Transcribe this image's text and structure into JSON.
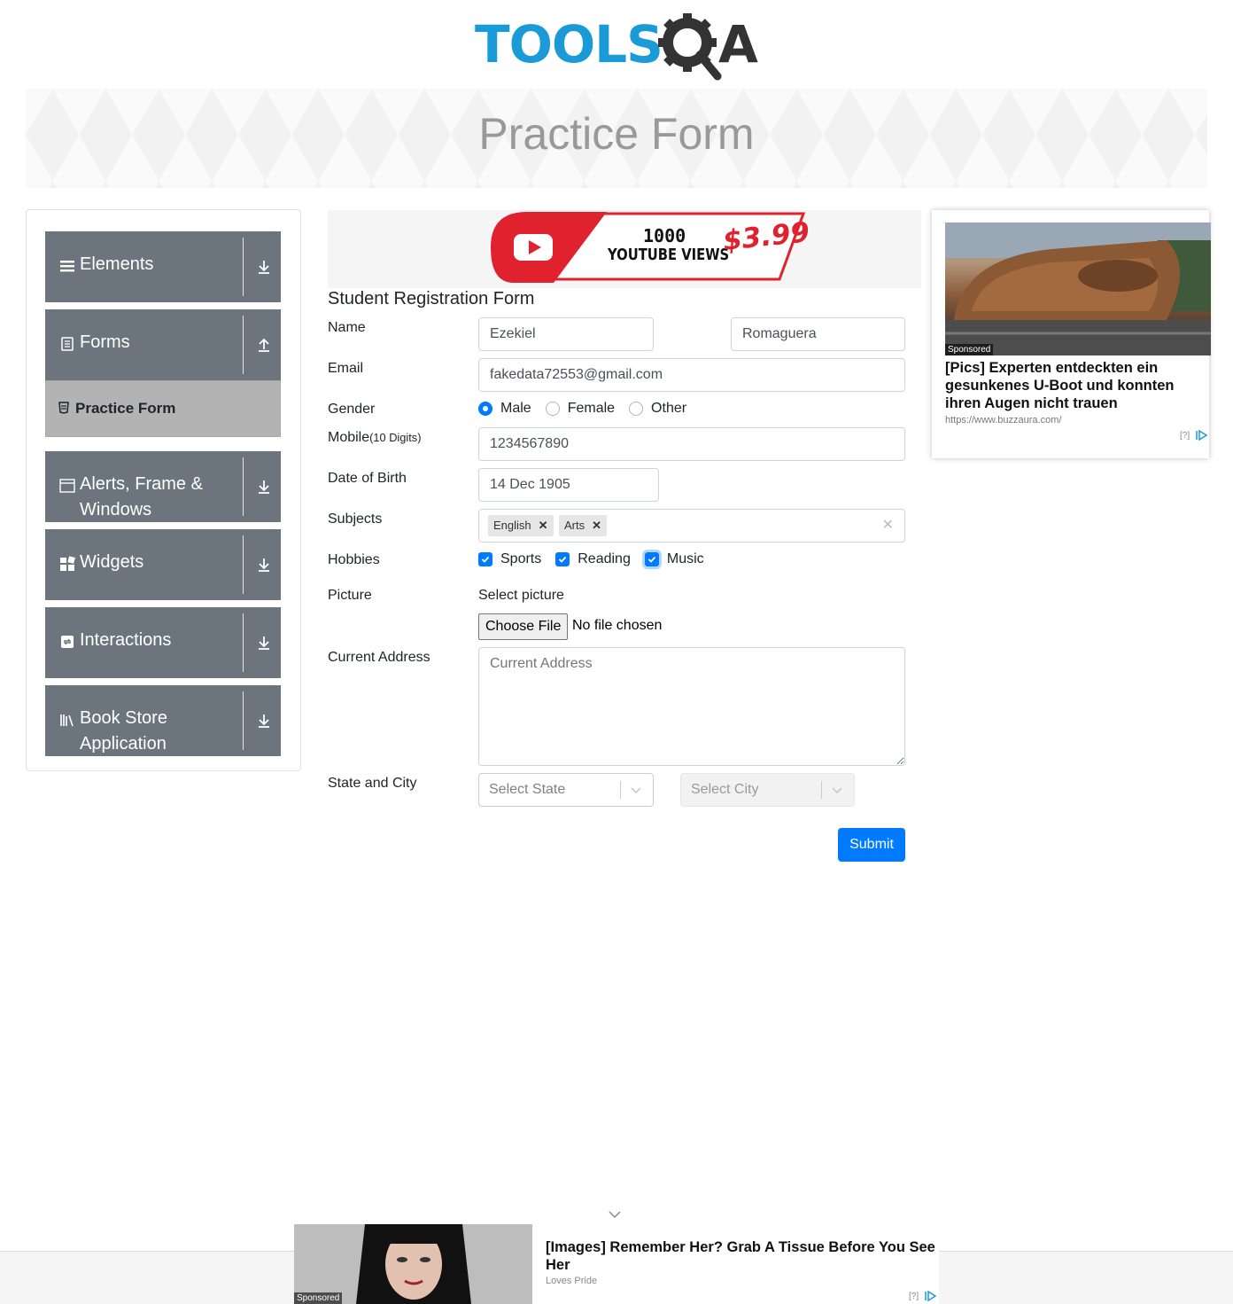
{
  "header": {
    "logo_text": "TOOLS",
    "logo_suffix": "A"
  },
  "banner": {
    "title": "Practice Form"
  },
  "sidebar": {
    "groups": [
      {
        "label": "Elements",
        "icon": "hamburger-icon",
        "toggle": "download-icon"
      },
      {
        "label": "Forms",
        "icon": "document-icon",
        "toggle": "upload-icon"
      },
      {
        "label": "Alerts, Frame & Windows",
        "icon": "window-icon",
        "toggle": "download-icon"
      },
      {
        "label": "Widgets",
        "icon": "widgets-icon",
        "toggle": "download-icon"
      },
      {
        "label": "Interactions",
        "icon": "interactions-icon",
        "toggle": "download-icon"
      },
      {
        "label": "Book Store Application",
        "icon": "books-icon",
        "toggle": "download-icon"
      }
    ],
    "active_item": "Practice Form"
  },
  "ad_top": {
    "line1": "1000",
    "line2": "YOUTUBE VIEWS",
    "price": "$3.99"
  },
  "form": {
    "title": "Student Registration Form",
    "labels": {
      "name": "Name",
      "email": "Email",
      "gender": "Gender",
      "mobile": "Mobile",
      "mobile_hint": "(10 Digits)",
      "dob": "Date of Birth",
      "subjects": "Subjects",
      "hobbies": "Hobbies",
      "picture": "Picture",
      "address": "Current Address",
      "state_city": "State and City"
    },
    "first_name": "Ezekiel",
    "last_name": "Romaguera",
    "email": "fakedata72553@gmail.com",
    "gender_options": [
      "Male",
      "Female",
      "Other"
    ],
    "gender_selected": "Male",
    "mobile": "1234567890",
    "dob": "14 Dec 1905",
    "subjects": [
      "English",
      "Arts"
    ],
    "hobbies": [
      {
        "label": "Sports",
        "checked": true
      },
      {
        "label": "Reading",
        "checked": true
      },
      {
        "label": "Music",
        "checked": true
      }
    ],
    "picture_label": "Select picture",
    "file_button": "Choose File",
    "file_status": "No file chosen",
    "address_placeholder": "Current Address",
    "state_placeholder": "Select State",
    "city_placeholder": "Select City",
    "submit": "Submit"
  },
  "ad_right": {
    "sponsored": "Sponsored",
    "headline": "[Pics] Experten entdeckten ein gesunkenes U-Boot und konnten ihren Augen nicht trauen",
    "url": "https://www.buzzaura.com/",
    "info": "[?]"
  },
  "ad_bottom": {
    "sponsored": "Sponsored",
    "headline": "[Images] Remember Her? Grab A Tissue Before You See Her",
    "source": "Loves Pride",
    "info": "[?]"
  },
  "colors": {
    "primary": "#007bff",
    "sidebar": "#6c757d",
    "logo_blue": "#1a9bd7"
  }
}
